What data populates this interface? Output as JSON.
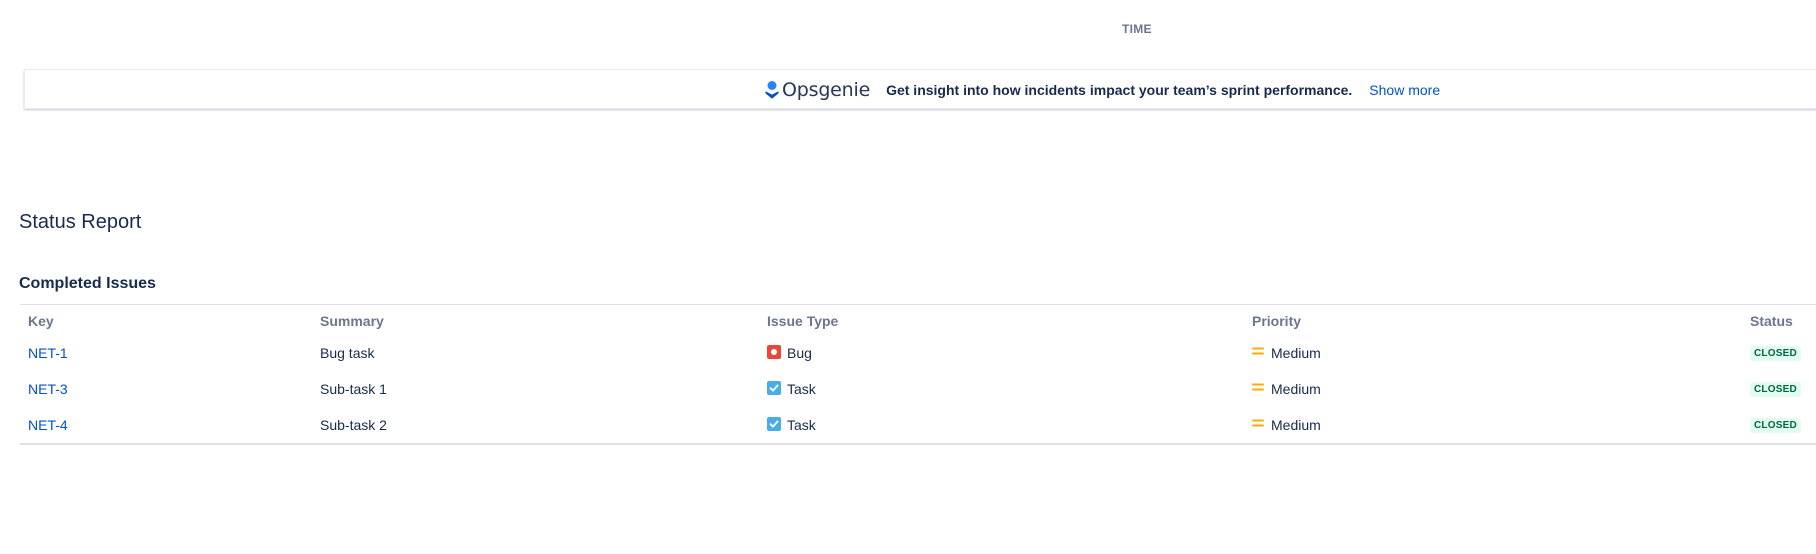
{
  "header": {
    "time_label": "TIME"
  },
  "banner": {
    "brand_name": "Opsgenie",
    "message": "Get insight into how incidents impact your team’s sprint performance.",
    "show_more": "Show more"
  },
  "report": {
    "title": "Status Report",
    "section_title": "Completed Issues",
    "columns": [
      "Key",
      "Summary",
      "Issue Type",
      "Priority",
      "Status"
    ],
    "rows": [
      {
        "key": "NET-1",
        "summary": "Bug task",
        "issue_type": "Bug",
        "issue_type_icon": "bug-icon",
        "priority": "Medium",
        "priority_icon": "priority-medium-icon",
        "status": "CLOSED"
      },
      {
        "key": "NET-3",
        "summary": "Sub-task 1",
        "issue_type": "Task",
        "issue_type_icon": "task-icon",
        "priority": "Medium",
        "priority_icon": "priority-medium-icon",
        "status": "CLOSED"
      },
      {
        "key": "NET-4",
        "summary": "Sub-task 2",
        "issue_type": "Task",
        "issue_type_icon": "task-icon",
        "priority": "Medium",
        "priority_icon": "priority-medium-icon",
        "status": "CLOSED"
      }
    ]
  },
  "colors": {
    "link": "#0052cc",
    "bug": "#e5493a",
    "task": "#4bade8",
    "priority_medium": "#ffab00",
    "status_closed_bg": "#e3fcef",
    "status_closed_text": "#006644",
    "opsgenie_brand": "#2684ff"
  }
}
